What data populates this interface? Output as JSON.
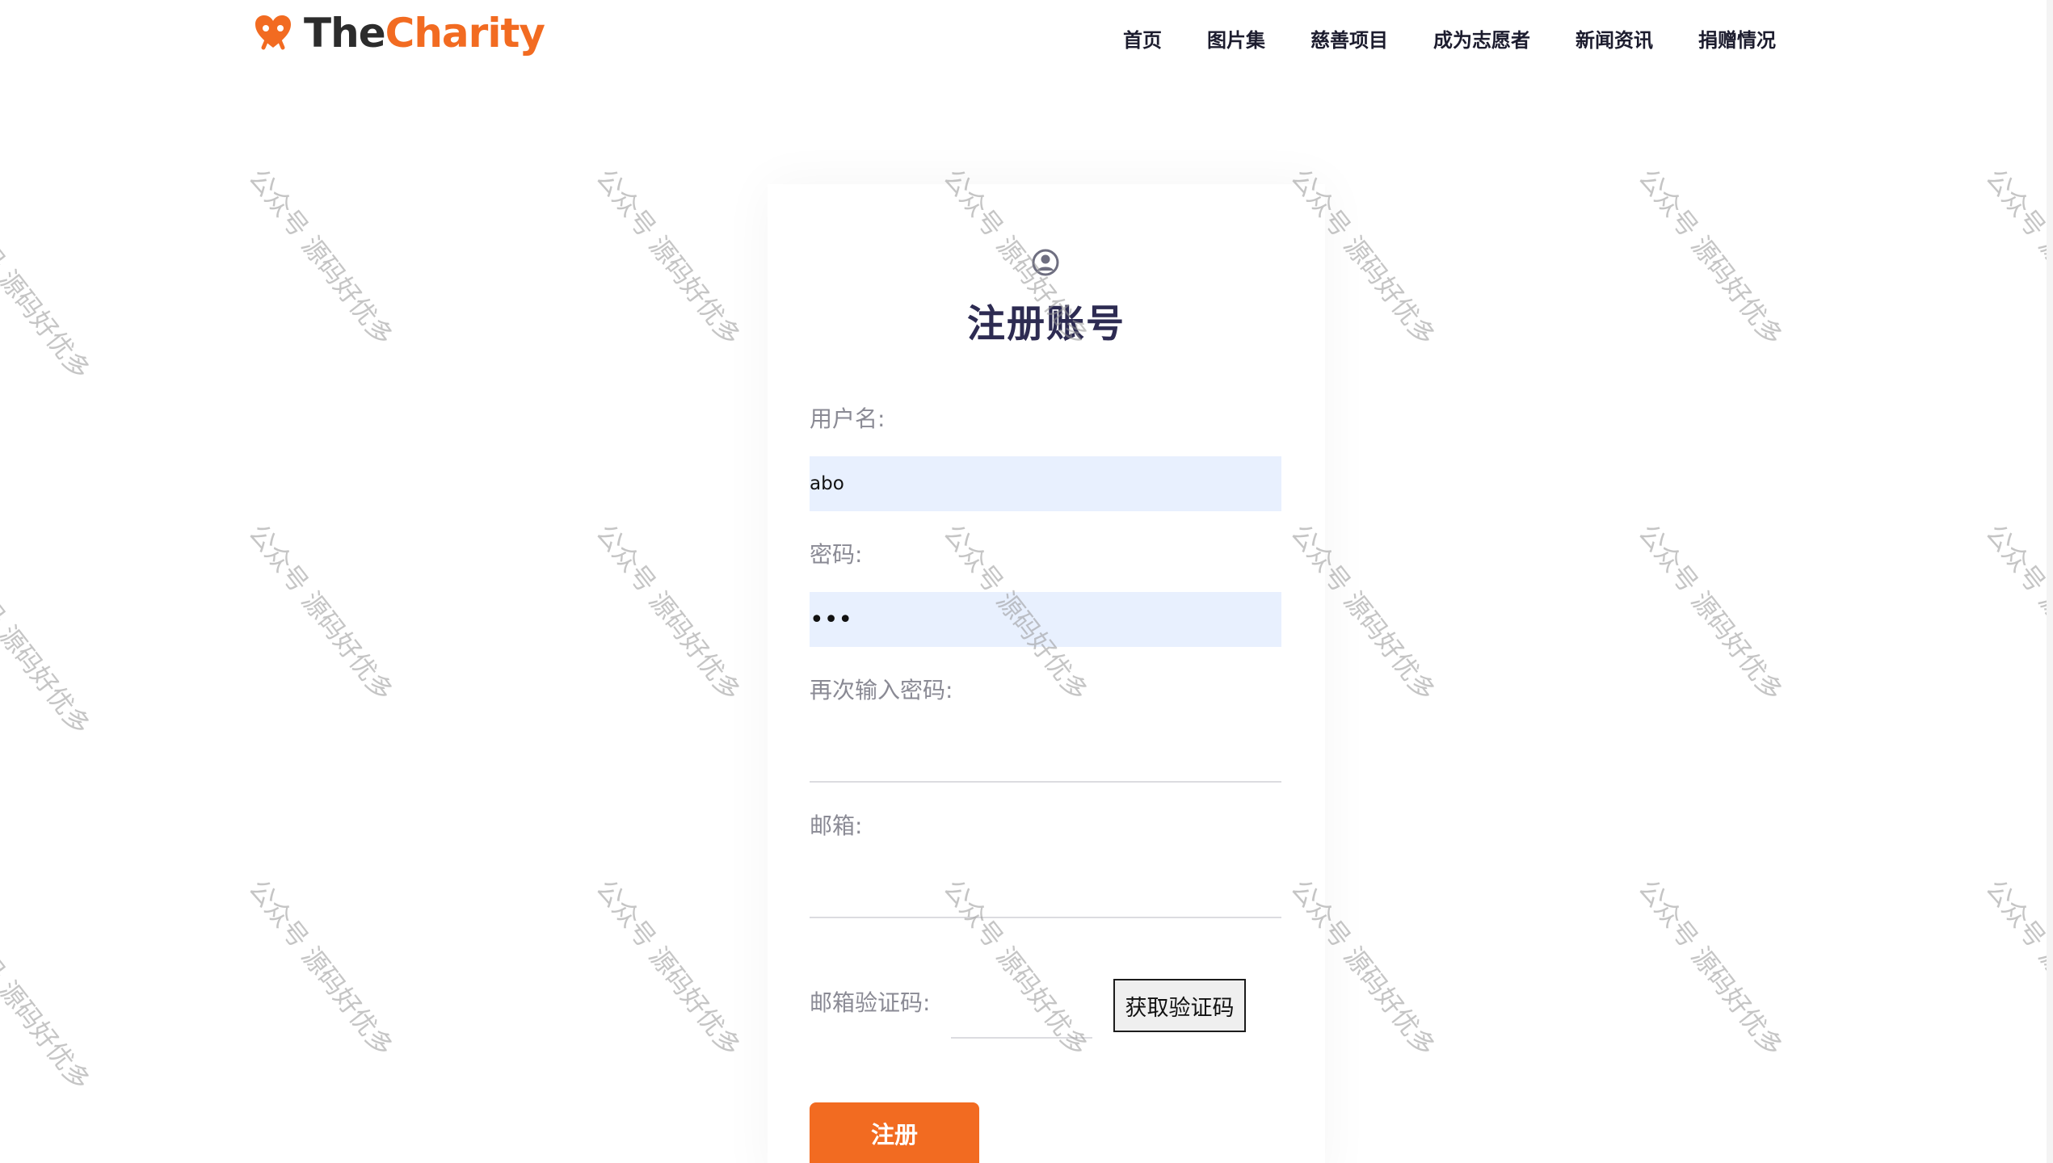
{
  "brand": {
    "name_part1": "The",
    "name_part2": "Charity",
    "accent_color": "#f26b21",
    "logo_icon": "heart-hands-icon"
  },
  "nav": {
    "items": [
      {
        "label": "首页"
      },
      {
        "label": "图片集"
      },
      {
        "label": "慈善项目"
      },
      {
        "label": "成为志愿者"
      },
      {
        "label": "新闻资讯"
      },
      {
        "label": "捐赠情况"
      }
    ]
  },
  "form": {
    "icon": "user-circle-icon",
    "title": "注册账号",
    "username": {
      "label": "用户名:",
      "value": "abo"
    },
    "password": {
      "label": "密码:",
      "value": "abc"
    },
    "confirm_password": {
      "label": "再次输入密码:",
      "value": ""
    },
    "email": {
      "label": "邮箱:",
      "value": ""
    },
    "email_code": {
      "label": "邮箱验证码:",
      "value": "",
      "button_label": "获取验证码"
    },
    "submit_label": "注册"
  },
  "watermark": {
    "text": "公众号 源码好优多"
  }
}
